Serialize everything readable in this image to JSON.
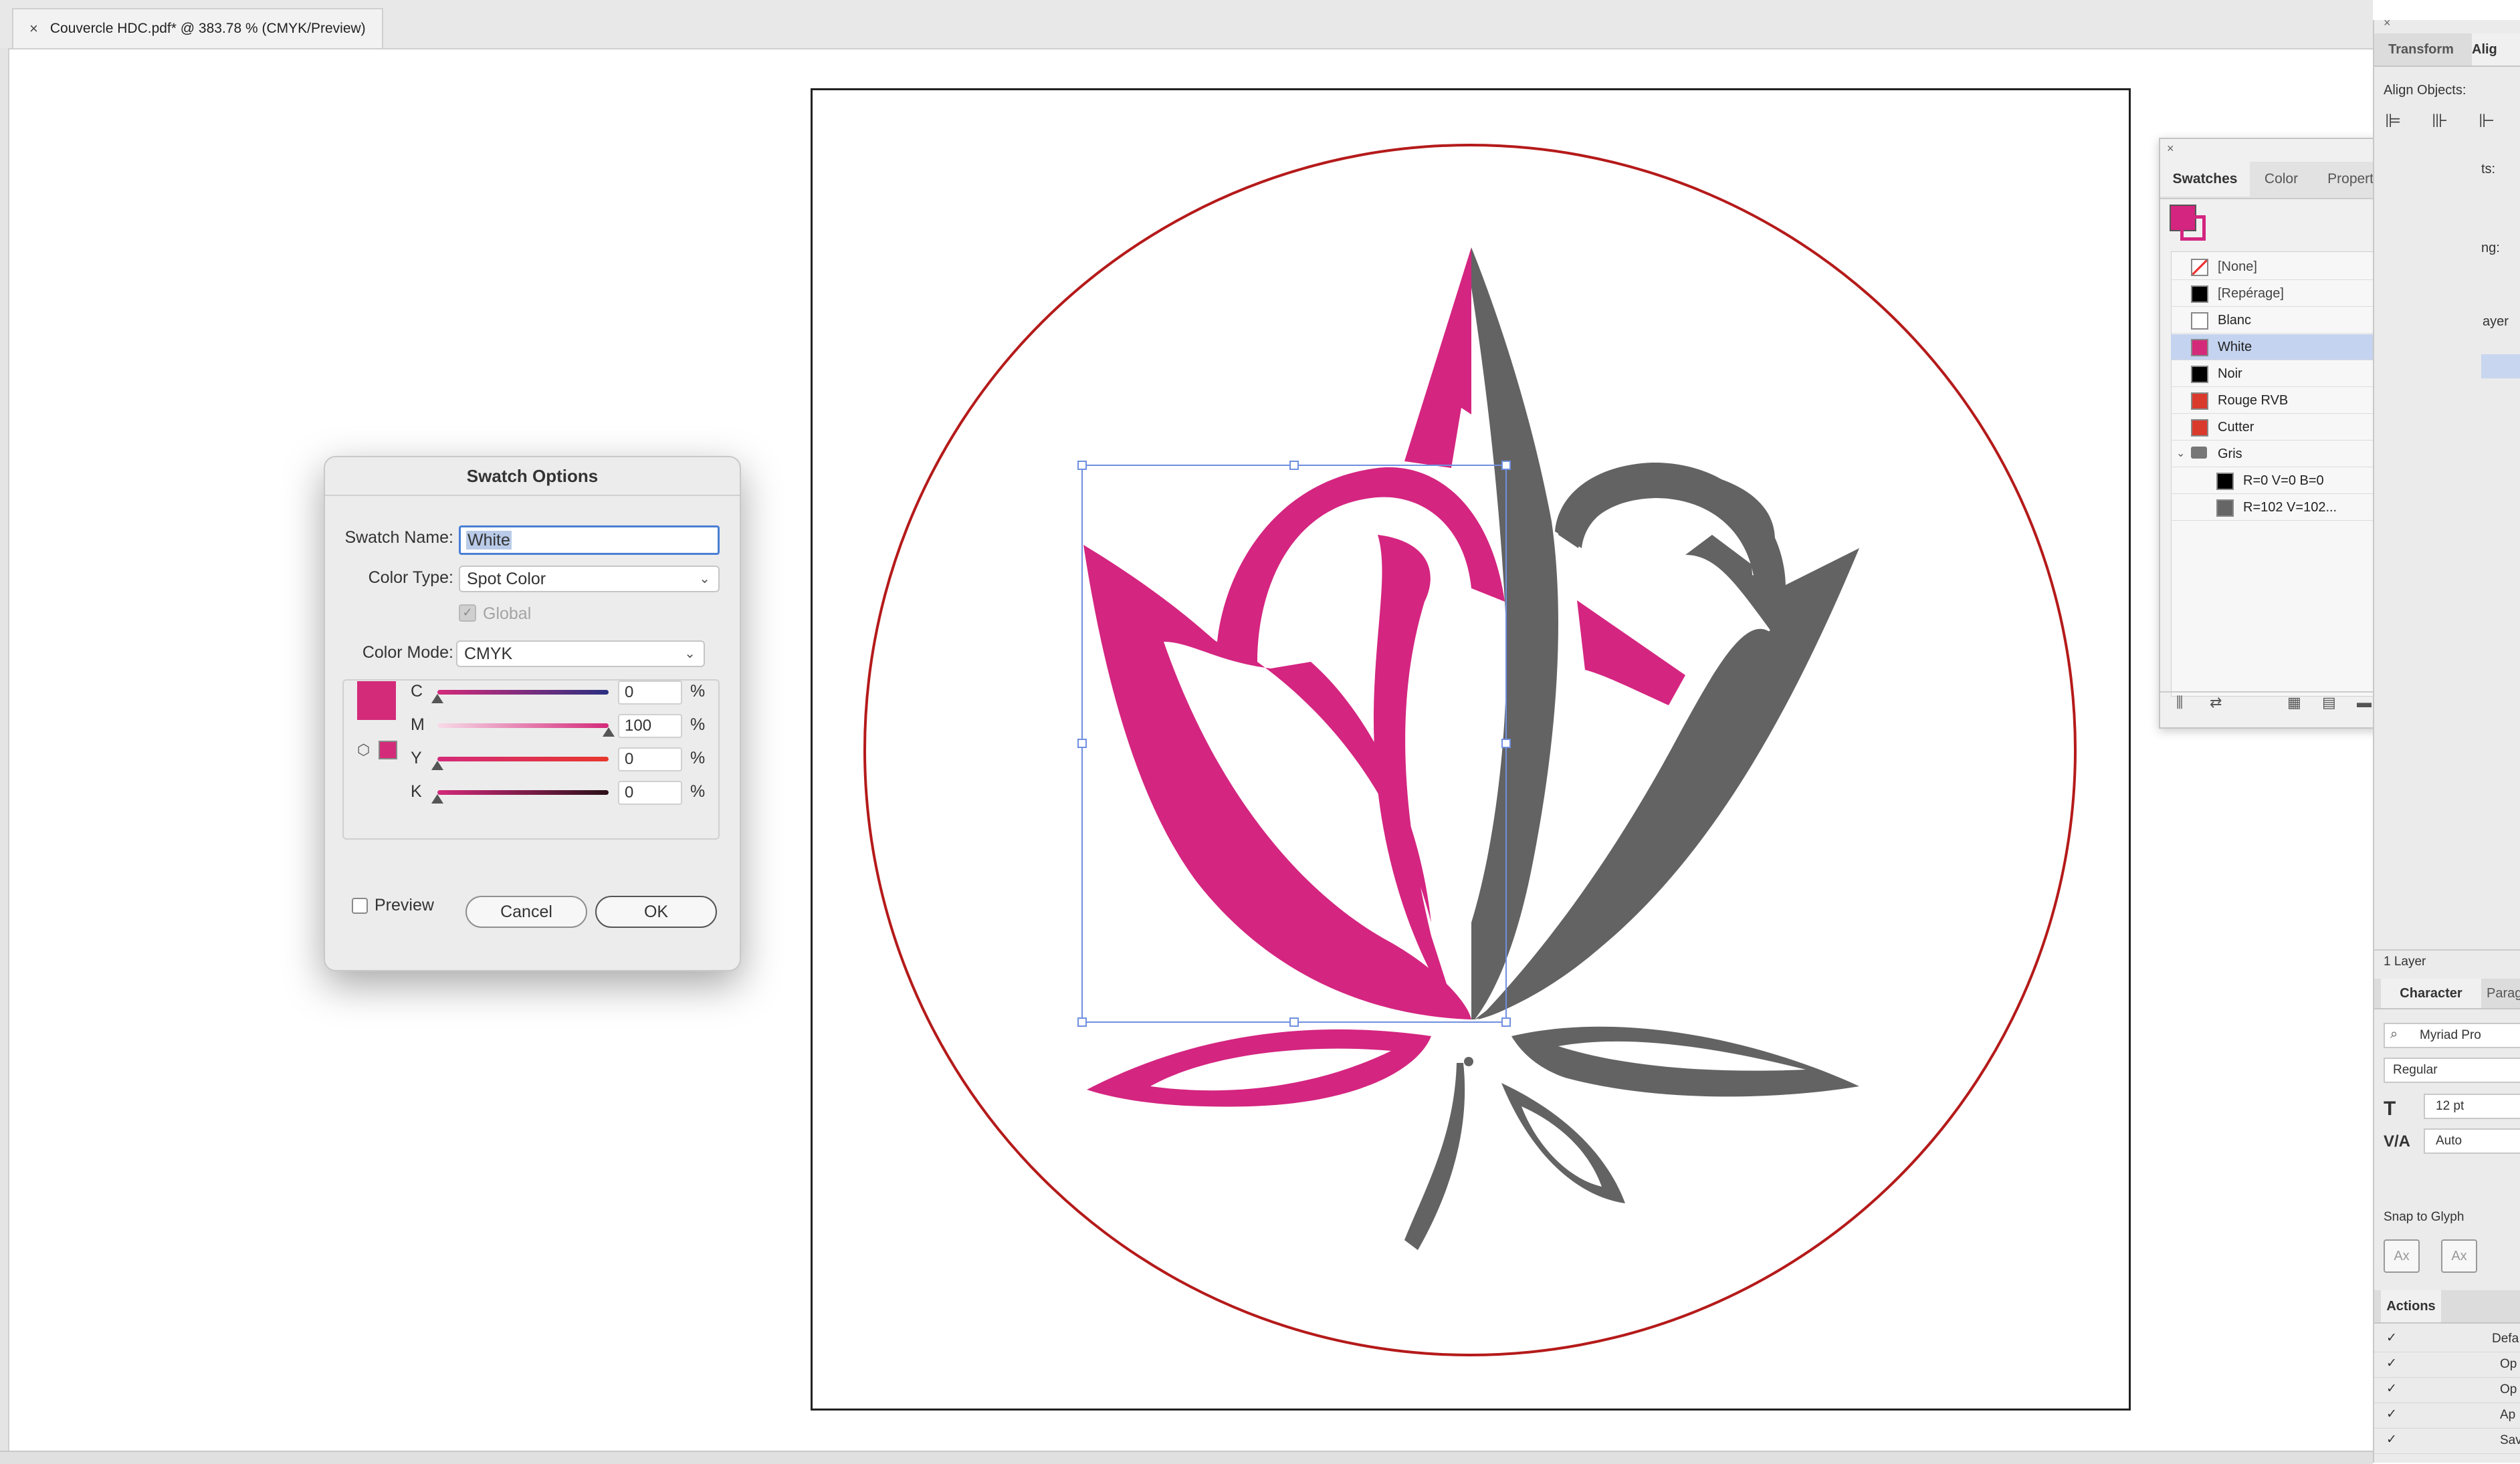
{
  "document": {
    "tab_title": "Couvercle HDC.pdf* @ 383.78 % (CMYK/Preview)",
    "close_glyph": "×"
  },
  "artwork": {
    "pink": "#d42580",
    "grey": "#636363",
    "cutline": "#b51a1a",
    "selection": "#6f8fe0"
  },
  "dialog": {
    "title": "Swatch Options",
    "swatch_name_label": "Swatch Name:",
    "swatch_name_value": "White",
    "color_type_label": "Color Type:",
    "color_type_value": "Spot Color",
    "global_label": "Global",
    "color_mode_label": "Color Mode:",
    "color_mode_value": "CMYK",
    "color_preview": "#d42a7a",
    "channels": [
      {
        "key": "C",
        "value": "0",
        "unit": "%",
        "level": 0
      },
      {
        "key": "M",
        "value": "100",
        "unit": "%",
        "level": 1
      },
      {
        "key": "Y",
        "value": "0",
        "unit": "%",
        "level": 0
      },
      {
        "key": "K",
        "value": "0",
        "unit": "%",
        "level": 0
      }
    ],
    "preview_label": "Preview",
    "cancel_label": "Cancel",
    "ok_label": "OK"
  },
  "swatches_panel": {
    "tabs": [
      "Swatches",
      "Color",
      "Properties"
    ],
    "items": [
      {
        "name": "[None]",
        "color": "none"
      },
      {
        "name": "[Repérage]",
        "color": "#000000"
      },
      {
        "name": "Blanc",
        "color": "#ffffff"
      },
      {
        "name": "White",
        "color": "#d42a7a",
        "selected": true
      },
      {
        "name": "Noir",
        "color": "#000000"
      },
      {
        "name": "Rouge RVB",
        "color": "#d93a2c"
      },
      {
        "name": "Cutter",
        "color": "#d93a2c"
      },
      {
        "name": "Gris",
        "color": "folder"
      },
      {
        "name": "R=0 V=0 B=0",
        "color": "#000000"
      },
      {
        "name": "R=102 V=102...",
        "color": "#666666"
      }
    ]
  },
  "dock": {
    "transform_tab": "Transform",
    "align_tab": "Alig",
    "align_objects_label": "Align Objects:",
    "dist_label": "ts:",
    "spacing_label": "ng:",
    "layers_label": "ayer",
    "layers_count": "1 Layer",
    "character_tab": "Character",
    "paragraph_tab": "Parag",
    "font_family": "Myriad Pro",
    "font_style": "Regular",
    "font_size": "12 pt",
    "tracking": "Auto",
    "snap_label": "Snap to Glyph",
    "actions_label": "Actions",
    "actions": [
      "Defa",
      "Op",
      "Op",
      "Ap",
      "Sav"
    ]
  }
}
